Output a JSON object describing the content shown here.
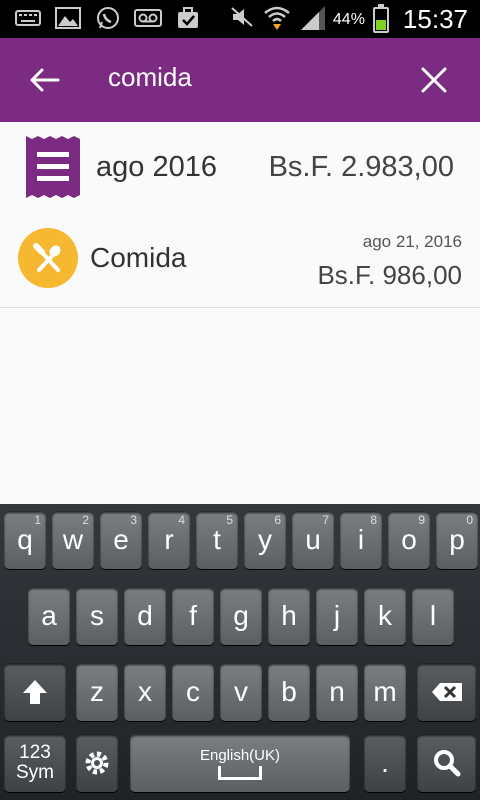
{
  "status_bar": {
    "battery_percent": "44%",
    "time": "15:37",
    "icons": [
      "keyboard-icon",
      "gallery-icon",
      "whatsapp-icon",
      "voicemail-icon",
      "briefcase-icon",
      "mute-icon",
      "wifi-icon",
      "signal-icon",
      "battery-icon"
    ]
  },
  "app_bar": {
    "query": "comida",
    "color": "#7b2c82"
  },
  "results": {
    "month": {
      "title": "ago 2016",
      "amount": "Bs.F. 2.983,00"
    },
    "category": {
      "title": "Comida",
      "date": "ago 21, 2016",
      "amount": "Bs.F. 986,00",
      "icon_color": "#f6b830"
    }
  },
  "keyboard": {
    "row1": [
      [
        "q",
        "1"
      ],
      [
        "w",
        "2"
      ],
      [
        "e",
        "3"
      ],
      [
        "r",
        "4"
      ],
      [
        "t",
        "5"
      ],
      [
        "y",
        "6"
      ],
      [
        "u",
        "7"
      ],
      [
        "i",
        "8"
      ],
      [
        "o",
        "9"
      ],
      [
        "p",
        "0"
      ]
    ],
    "row2": [
      "a",
      "s",
      "d",
      "f",
      "g",
      "h",
      "j",
      "k",
      "l"
    ],
    "row3": [
      "z",
      "x",
      "c",
      "v",
      "b",
      "n",
      "m"
    ],
    "sym_top": "123",
    "sym_bottom": "Sym",
    "space_label": "English(UK)",
    "period": "."
  }
}
